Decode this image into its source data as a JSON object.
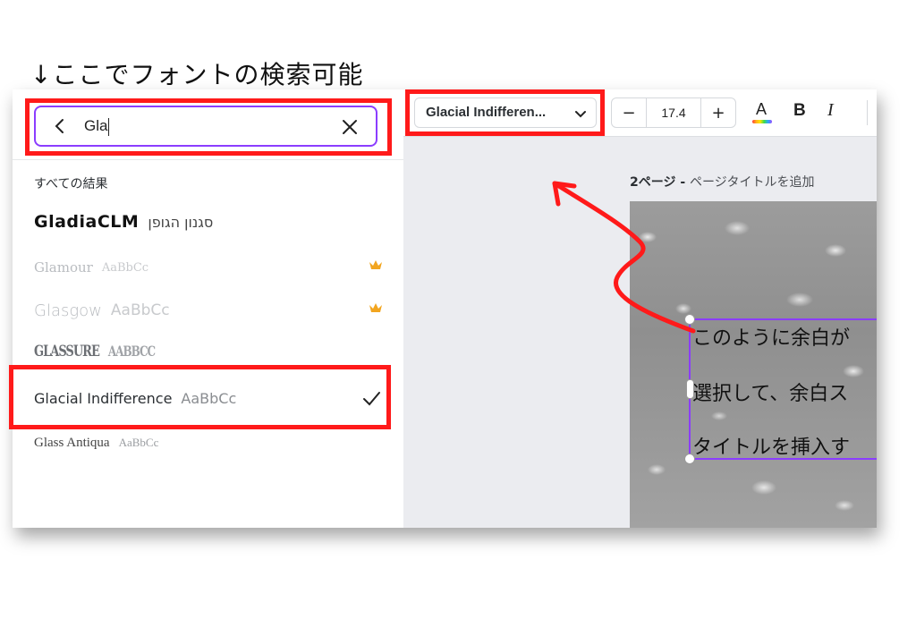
{
  "annotation": {
    "heading": "↓ここでフォントの検索可能",
    "highlight_color": "#ff1a1a",
    "arrow_color": "#ff1a1a"
  },
  "font_panel": {
    "search": {
      "query": "Gla",
      "back_icon": "chevron-left-icon",
      "clear_icon": "close-icon"
    },
    "results_title": "すべての結果",
    "results": [
      {
        "name": "GladiaCLM",
        "sample": "סגנון הגופן",
        "premium": false,
        "selected": false
      },
      {
        "name": "Glamour",
        "sample": "AaBbCc",
        "premium": true,
        "selected": false
      },
      {
        "name": "Glasgow",
        "sample": "AaBbCc",
        "premium": true,
        "selected": false
      },
      {
        "name": "GLASSURE",
        "sample": "AABBCC",
        "premium": false,
        "selected": false
      },
      {
        "name": "Glacial Indifference",
        "sample": "AaBbCc",
        "premium": false,
        "selected": true
      },
      {
        "name": "Glass Antiqua",
        "sample": "AaBbCc",
        "premium": false,
        "selected": false
      }
    ]
  },
  "toolbar": {
    "font_name": "Glacial Indifferen...",
    "font_size": "17.4",
    "decrease_label": "−",
    "increase_label": "+",
    "text_color_label": "A",
    "bold_label": "B",
    "italic_label": "I",
    "accent_color": "#8b3dff"
  },
  "canvas": {
    "page_number": "2ページ",
    "page_title_separator": " - ",
    "page_title_placeholder": "ページタイトルを追加",
    "text_lines": [
      "このように余白が",
      "選択して、余白ス",
      "タイトルを挿入す"
    ]
  }
}
